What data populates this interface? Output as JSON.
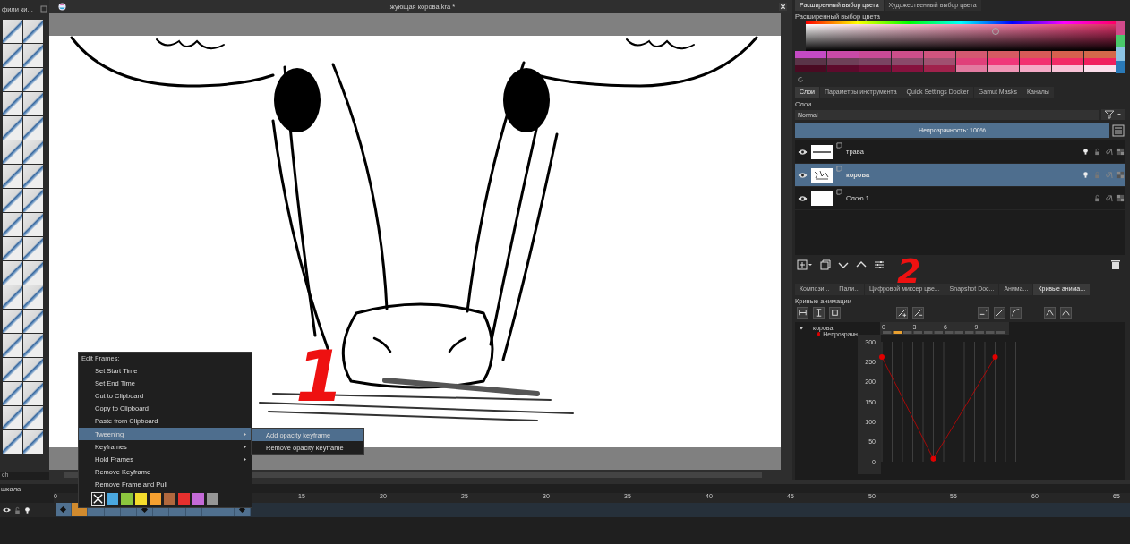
{
  "left_docker": {
    "title": "фили ки...",
    "filter": {
      "value": "ch"
    }
  },
  "document": {
    "title": "жующая корова.kra *"
  },
  "annotations": [
    {
      "text": "1"
    },
    {
      "text": "2"
    }
  ],
  "context_menu": {
    "header": "Edit Frames:",
    "items": [
      {
        "label": "Set Start Time",
        "selected": false,
        "submenu": false
      },
      {
        "label": "Set End Time",
        "selected": false,
        "submenu": false
      },
      {
        "label": "Cut to Clipboard",
        "selected": false,
        "submenu": false
      },
      {
        "label": "Copy to Clipboard",
        "selected": false,
        "submenu": false
      },
      {
        "label": "Paste from Clipboard",
        "selected": false,
        "submenu": false
      },
      {
        "label": "Tweening",
        "selected": true,
        "submenu": true
      },
      {
        "label": "Keyframes",
        "selected": false,
        "submenu": true
      },
      {
        "label": "Hold Frames",
        "selected": false,
        "submenu": true
      },
      {
        "label": "Remove Keyframe",
        "selected": false,
        "submenu": false
      },
      {
        "label": "Remove Frame and Pull",
        "selected": false,
        "submenu": false
      }
    ],
    "swatches": [
      {
        "kind": "none",
        "selected": true
      },
      {
        "kind": "color",
        "color": "#4aa8e0",
        "selected": false
      },
      {
        "kind": "color",
        "color": "#8cc63e",
        "selected": false
      },
      {
        "kind": "color",
        "color": "#f4dc2c",
        "selected": false
      },
      {
        "kind": "color",
        "color": "#f5a030",
        "selected": false
      },
      {
        "kind": "color",
        "color": "#b0683e",
        "selected": false
      },
      {
        "kind": "color",
        "color": "#e6302e",
        "selected": false
      },
      {
        "kind": "color",
        "color": "#c46ad8",
        "selected": false
      },
      {
        "kind": "color",
        "color": "#969696",
        "selected": false
      }
    ],
    "submenu": [
      {
        "label": "Add opacity keyframe",
        "selected": true
      },
      {
        "label": "Remove opacity keyframe",
        "selected": false
      }
    ]
  },
  "color_docker": {
    "tabs": [
      {
        "label": "Расширенный выбор цвета",
        "selected": true
      },
      {
        "label": "Художественный выбор цвета",
        "selected": false
      }
    ],
    "title": "Расширенный выбор цвета"
  },
  "layers_docker": {
    "tabs": [
      {
        "label": "Слои",
        "selected": true
      },
      {
        "label": "Параметры инструмента",
        "selected": false
      },
      {
        "label": "Quick Settings Docker",
        "selected": false
      },
      {
        "label": "Gamut Masks",
        "selected": false
      },
      {
        "label": "Каналы",
        "selected": false
      }
    ],
    "title": "Слои",
    "blend_mode": "Normal",
    "opacity": {
      "label": "Непрозрачность:  100%",
      "level": 1
    },
    "layers": [
      {
        "name": "трава",
        "kind": "strip",
        "selected": false,
        "visible": true,
        "onion_skin": true
      },
      {
        "name": "корова",
        "kind": "sketch",
        "selected": true,
        "visible": true,
        "onion_skin": true
      },
      {
        "name": "Слою 1",
        "kind": "blank",
        "selected": false,
        "visible": true,
        "onion_skin": false
      }
    ]
  },
  "curves_docker": {
    "tabs": [
      {
        "label": "Компози...",
        "selected": false
      },
      {
        "label": "Пали...",
        "selected": false
      },
      {
        "label": "Цифровой миксер цве...",
        "selected": false
      },
      {
        "label": "Snapshot Doc...",
        "selected": false
      },
      {
        "label": "Анима...",
        "selected": false
      },
      {
        "label": "Кривые анима...",
        "selected": true
      }
    ],
    "title": "Кривые анимации",
    "tree": [
      {
        "label": "корова",
        "expanded": true,
        "children": [
          {
            "label": "Непрозрачн",
            "color": "#e00000"
          }
        ]
      }
    ],
    "chart_data": {
      "type": "line",
      "grid": true,
      "x": [
        0,
        5,
        11
      ],
      "series": [
        {
          "color": "#e00000",
          "marker": true,
          "values": [
            262,
            7,
            262
          ]
        }
      ],
      "xlim": [
        0,
        12
      ],
      "ylim": [
        0,
        300
      ],
      "xticks": [
        0,
        3,
        6,
        9
      ],
      "yticks": [
        0,
        50,
        100,
        150,
        200,
        250,
        300
      ]
    }
  },
  "timeline": {
    "title": "шкала",
    "ruler": [
      "0",
      "15",
      "20",
      "25",
      "30",
      "35",
      "40",
      "45",
      "50",
      "55",
      "60",
      "65"
    ],
    "frames": [
      {
        "keyframe": true,
        "selected": false
      },
      {
        "keyframe": false,
        "selected": true
      },
      {
        "keyframe": false,
        "selected": false
      },
      {
        "keyframe": false,
        "selected": false
      },
      {
        "keyframe": false,
        "selected": false
      },
      {
        "keyframe": true,
        "selected": false
      },
      {
        "keyframe": false,
        "selected": false
      },
      {
        "keyframe": false,
        "selected": false
      },
      {
        "keyframe": false,
        "selected": false
      },
      {
        "keyframe": false,
        "selected": false
      },
      {
        "keyframe": false,
        "selected": false
      },
      {
        "keyframe": true,
        "selected": false
      }
    ]
  }
}
